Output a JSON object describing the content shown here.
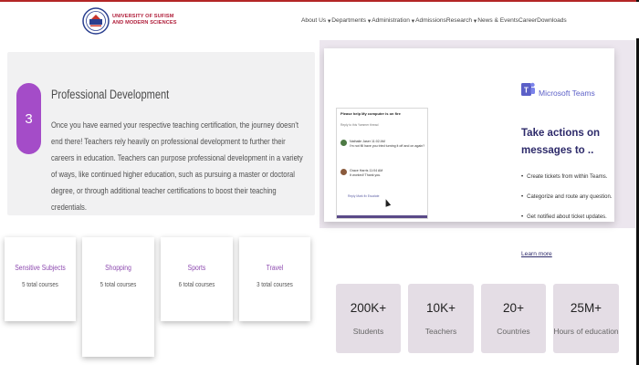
{
  "header": {
    "brand_line1": "UNIVERSITY OF SUFISM",
    "brand_line2": "AND MODERN SCIENCES",
    "nav": [
      "About Us",
      "Departments",
      "Administration",
      "Admissions",
      "Research",
      "News & Events",
      "Career",
      "Downloads"
    ]
  },
  "professional_development": {
    "step": "3",
    "title": "Professional Development",
    "body": "Once you have earned your respective teaching certification, the journey doesn't end there! Teachers rely heavily on professional development to further their careers in education. Teachers can purpose professional development in a variety of ways, like continued higher education, such as pursuing a master or doctoral degree, or through additional teacher certifications to boost their teaching credentials."
  },
  "categories": [
    {
      "name": "Sensitive Subjects",
      "count": "5 total courses"
    },
    {
      "name": "Shopping",
      "count": "5 total courses"
    },
    {
      "name": "Sports",
      "count": "6 total courses"
    },
    {
      "name": "Travel",
      "count": "3 total courses"
    }
  ],
  "teams": {
    "logo_label": "Microsoft Teams",
    "headline": "Take actions on messages to ..",
    "bullets": [
      "Create tickets from within Teams.",
      "Categorize and route any question.",
      "Get notified about ticket updates."
    ],
    "learn_more": "Learn more",
    "chat": {
      "title": "Please help My computer is on fire",
      "sub": "Reply to this Yammer thread",
      "msg1_name": "Nathalie Jaser",
      "msg1_time": "11:02 AM",
      "msg1_text": "I'm not fill have you tried turning it off and on again?",
      "msg2_name": "Grace Harris",
      "msg2_time": "11:04 AM",
      "msg2_text": "It worked! Thank you.",
      "actions": "Reply   Mark fix   Escalate"
    }
  },
  "stats": [
    {
      "value": "200K+",
      "label": "Students"
    },
    {
      "value": "10K+",
      "label": "Teachers"
    },
    {
      "value": "20+",
      "label": "Countries"
    },
    {
      "value": "25M+",
      "label": "Hours of education"
    }
  ],
  "colors": {
    "accent_purple": "#a44cc8",
    "teams_purple": "#5b5fc7",
    "brand_red": "#b01e3a",
    "stat_bg": "#e4dde5"
  }
}
